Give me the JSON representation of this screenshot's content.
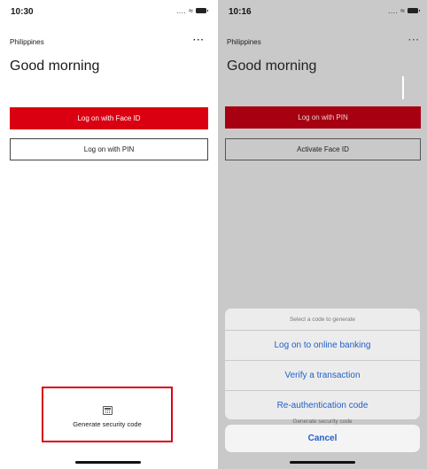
{
  "left": {
    "status": {
      "time": "10:30",
      "signal": "....",
      "wifi": "wifi-icon",
      "battery": "battery-icon"
    },
    "region": "Philippines",
    "more_label": "···",
    "greeting": "Good morning",
    "primary_button": "Log on with Face ID",
    "secondary_button": "Log on with PIN",
    "generate": {
      "icon": "calculator-icon",
      "label": "Generate security code"
    }
  },
  "right": {
    "status": {
      "time": "10:16",
      "signal": "....",
      "wifi": "wifi-icon",
      "battery": "battery-icon"
    },
    "region": "Philippines",
    "more_label": "···",
    "greeting": "Good morning",
    "primary_button": "Log on with PIN",
    "secondary_button": "Activate Face ID",
    "sheet": {
      "title": "Select a code to generate",
      "options": [
        "Log on to online banking",
        "Verify a transaction",
        "Re-authentication code"
      ],
      "peek_text": "Generate security code",
      "cancel": "Cancel"
    }
  },
  "colors": {
    "brand_red": "#db0011",
    "link_blue": "#2260c8",
    "highlight": "#db0011"
  }
}
